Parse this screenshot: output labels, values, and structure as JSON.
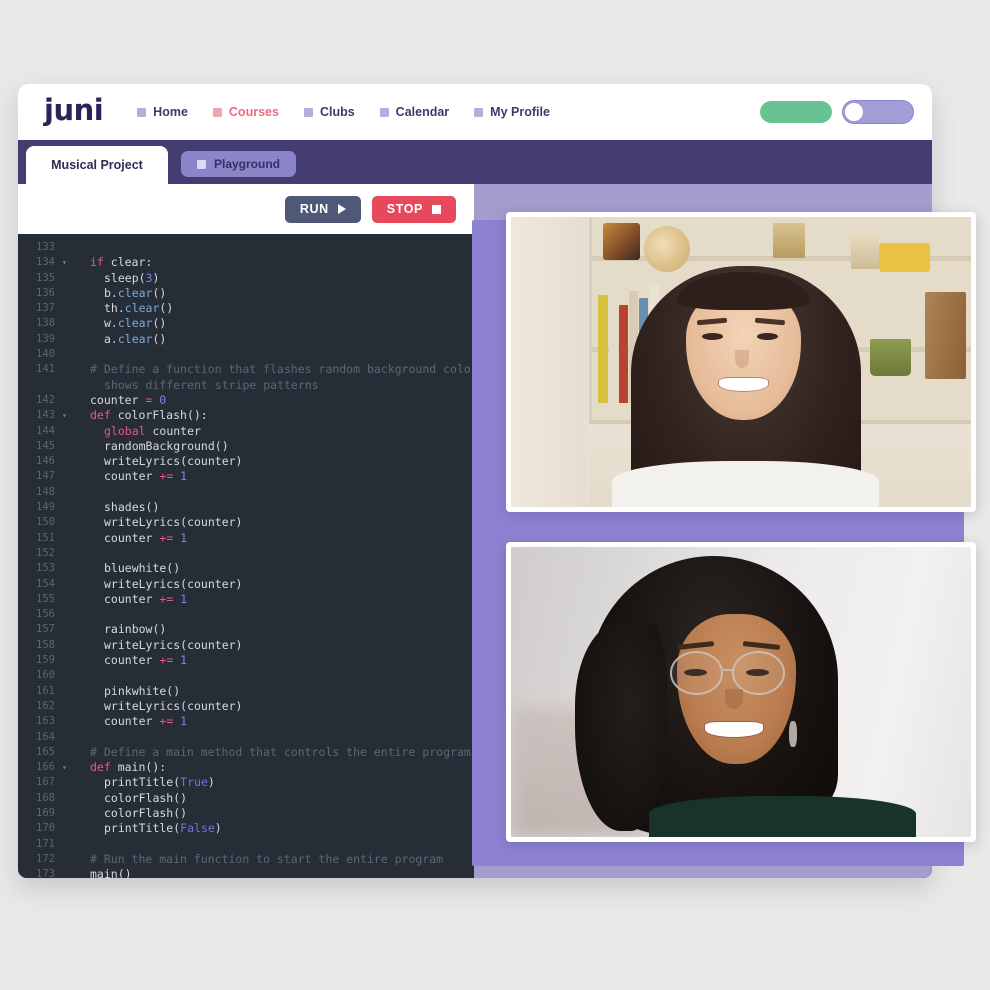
{
  "app": {
    "logo": "juni",
    "nav": [
      {
        "label": "Home",
        "icon": "square-icon",
        "active": false
      },
      {
        "label": "Courses",
        "icon": "square-icon",
        "active": true
      },
      {
        "label": "Clubs",
        "icon": "square-icon",
        "active": false
      },
      {
        "label": "Calendar",
        "icon": "square-icon",
        "active": false
      },
      {
        "label": "My Profile",
        "icon": "square-icon",
        "active": false
      }
    ],
    "controls": {
      "green_pill": "",
      "toggle": "",
      "toggle_state": "off"
    }
  },
  "tabs": {
    "active": "Musical Project",
    "playground": "Playground",
    "playground_icon": "square-icon"
  },
  "toolbar": {
    "run_label": "RUN",
    "run_icon": "play-triangle-icon",
    "stop_label": "STOP",
    "stop_icon": "stop-square-icon"
  },
  "editor": {
    "language": "python",
    "first_line": 133,
    "last_line": 173,
    "lines": [
      {
        "n": 133,
        "fold": "",
        "indent": 0,
        "tokens": []
      },
      {
        "n": 134,
        "fold": "v",
        "indent": 1,
        "tokens": [
          {
            "t": "if ",
            "c": "kw"
          },
          {
            "t": "clear:",
            "c": "code-txt"
          }
        ]
      },
      {
        "n": 135,
        "fold": "",
        "indent": 2,
        "tokens": [
          {
            "t": "sleep(",
            "c": "code-txt"
          },
          {
            "t": "3",
            "c": "num"
          },
          {
            "t": ")",
            "c": "code-txt"
          }
        ]
      },
      {
        "n": 136,
        "fold": "",
        "indent": 2,
        "tokens": [
          {
            "t": "b.",
            "c": "code-txt"
          },
          {
            "t": "clear",
            "c": "method"
          },
          {
            "t": "()",
            "c": "code-txt"
          }
        ]
      },
      {
        "n": 137,
        "fold": "",
        "indent": 2,
        "tokens": [
          {
            "t": "th.",
            "c": "code-txt"
          },
          {
            "t": "clear",
            "c": "method"
          },
          {
            "t": "()",
            "c": "code-txt"
          }
        ]
      },
      {
        "n": 138,
        "fold": "",
        "indent": 2,
        "tokens": [
          {
            "t": "w.",
            "c": "code-txt"
          },
          {
            "t": "clear",
            "c": "method"
          },
          {
            "t": "()",
            "c": "code-txt"
          }
        ]
      },
      {
        "n": 139,
        "fold": "",
        "indent": 2,
        "tokens": [
          {
            "t": "a.",
            "c": "code-txt"
          },
          {
            "t": "clear",
            "c": "method"
          },
          {
            "t": "()",
            "c": "code-txt"
          }
        ]
      },
      {
        "n": 140,
        "fold": "",
        "indent": 0,
        "tokens": []
      },
      {
        "n": 141,
        "fold": "",
        "indent": 1,
        "tokens": [
          {
            "t": "# Define a function that flashes random background colors, ma",
            "c": "comment"
          }
        ]
      },
      {
        "n": "",
        "fold": "",
        "indent": 2,
        "tokens": [
          {
            "t": "shows different stripe patterns",
            "c": "comment"
          }
        ]
      },
      {
        "n": 142,
        "fold": "",
        "indent": 1,
        "tokens": [
          {
            "t": "counter ",
            "c": "code-txt"
          },
          {
            "t": "= ",
            "c": "op"
          },
          {
            "t": "0",
            "c": "num"
          }
        ]
      },
      {
        "n": 143,
        "fold": "v",
        "indent": 1,
        "tokens": [
          {
            "t": "def ",
            "c": "kw"
          },
          {
            "t": "colorFlash():",
            "c": "code-txt"
          }
        ]
      },
      {
        "n": 144,
        "fold": "",
        "indent": 2,
        "tokens": [
          {
            "t": "global ",
            "c": "kw"
          },
          {
            "t": "counter",
            "c": "code-txt"
          }
        ]
      },
      {
        "n": 145,
        "fold": "",
        "indent": 2,
        "tokens": [
          {
            "t": "randomBackground()",
            "c": "code-txt"
          }
        ]
      },
      {
        "n": 146,
        "fold": "",
        "indent": 2,
        "tokens": [
          {
            "t": "writeLyrics(counter)",
            "c": "code-txt"
          }
        ]
      },
      {
        "n": 147,
        "fold": "",
        "indent": 2,
        "tokens": [
          {
            "t": "counter ",
            "c": "code-txt"
          },
          {
            "t": "+= ",
            "c": "op"
          },
          {
            "t": "1",
            "c": "num"
          }
        ]
      },
      {
        "n": 148,
        "fold": "",
        "indent": 0,
        "tokens": []
      },
      {
        "n": 149,
        "fold": "",
        "indent": 2,
        "tokens": [
          {
            "t": "shades()",
            "c": "code-txt"
          }
        ]
      },
      {
        "n": 150,
        "fold": "",
        "indent": 2,
        "tokens": [
          {
            "t": "writeLyrics(counter)",
            "c": "code-txt"
          }
        ]
      },
      {
        "n": 151,
        "fold": "",
        "indent": 2,
        "tokens": [
          {
            "t": "counter ",
            "c": "code-txt"
          },
          {
            "t": "+= ",
            "c": "op"
          },
          {
            "t": "1",
            "c": "num"
          }
        ]
      },
      {
        "n": 152,
        "fold": "",
        "indent": 0,
        "tokens": []
      },
      {
        "n": 153,
        "fold": "",
        "indent": 2,
        "tokens": [
          {
            "t": "bluewhite()",
            "c": "code-txt"
          }
        ]
      },
      {
        "n": 154,
        "fold": "",
        "indent": 2,
        "tokens": [
          {
            "t": "writeLyrics(counter)",
            "c": "code-txt"
          }
        ]
      },
      {
        "n": 155,
        "fold": "",
        "indent": 2,
        "tokens": [
          {
            "t": "counter ",
            "c": "code-txt"
          },
          {
            "t": "+= ",
            "c": "op"
          },
          {
            "t": "1",
            "c": "num"
          }
        ]
      },
      {
        "n": 156,
        "fold": "",
        "indent": 0,
        "tokens": []
      },
      {
        "n": 157,
        "fold": "",
        "indent": 2,
        "tokens": [
          {
            "t": "rainbow()",
            "c": "code-txt"
          }
        ]
      },
      {
        "n": 158,
        "fold": "",
        "indent": 2,
        "tokens": [
          {
            "t": "writeLyrics(counter)",
            "c": "code-txt"
          }
        ]
      },
      {
        "n": 159,
        "fold": "",
        "indent": 2,
        "tokens": [
          {
            "t": "counter ",
            "c": "code-txt"
          },
          {
            "t": "+= ",
            "c": "op"
          },
          {
            "t": "1",
            "c": "num"
          }
        ]
      },
      {
        "n": 160,
        "fold": "",
        "indent": 0,
        "tokens": []
      },
      {
        "n": 161,
        "fold": "",
        "indent": 2,
        "tokens": [
          {
            "t": "pinkwhite()",
            "c": "code-txt"
          }
        ]
      },
      {
        "n": 162,
        "fold": "",
        "indent": 2,
        "tokens": [
          {
            "t": "writeLyrics(counter)",
            "c": "code-txt"
          }
        ]
      },
      {
        "n": 163,
        "fold": "",
        "indent": 2,
        "tokens": [
          {
            "t": "counter ",
            "c": "code-txt"
          },
          {
            "t": "+= ",
            "c": "op"
          },
          {
            "t": "1",
            "c": "num"
          }
        ]
      },
      {
        "n": 164,
        "fold": "",
        "indent": 0,
        "tokens": []
      },
      {
        "n": 165,
        "fold": "",
        "indent": 1,
        "tokens": [
          {
            "t": "# Define a main method that controls the entire program",
            "c": "comment"
          }
        ]
      },
      {
        "n": 166,
        "fold": "v",
        "indent": 1,
        "tokens": [
          {
            "t": "def ",
            "c": "kw"
          },
          {
            "t": "main():",
            "c": "code-txt"
          }
        ]
      },
      {
        "n": 167,
        "fold": "",
        "indent": 2,
        "tokens": [
          {
            "t": "printTitle(",
            "c": "code-txt"
          },
          {
            "t": "True",
            "c": "bool"
          },
          {
            "t": ")",
            "c": "code-txt"
          }
        ]
      },
      {
        "n": 168,
        "fold": "",
        "indent": 2,
        "tokens": [
          {
            "t": "colorFlash()",
            "c": "code-txt"
          }
        ]
      },
      {
        "n": 169,
        "fold": "",
        "indent": 2,
        "tokens": [
          {
            "t": "colorFlash()",
            "c": "code-txt"
          }
        ]
      },
      {
        "n": 170,
        "fold": "",
        "indent": 2,
        "tokens": [
          {
            "t": "printTitle(",
            "c": "code-txt"
          },
          {
            "t": "False",
            "c": "bool"
          },
          {
            "t": ")",
            "c": "code-txt"
          }
        ]
      },
      {
        "n": 171,
        "fold": "",
        "indent": 0,
        "tokens": []
      },
      {
        "n": 172,
        "fold": "",
        "indent": 1,
        "tokens": [
          {
            "t": "# Run the main function to start the entire program",
            "c": "comment"
          }
        ]
      },
      {
        "n": 173,
        "fold": "",
        "indent": 1,
        "tokens": [
          {
            "t": "main()",
            "c": "code-txt"
          }
        ]
      }
    ]
  },
  "video_panel": {
    "participants": [
      {
        "name": "participant-1",
        "description": "Smiling young woman with long dark hair wearing a white top, seated in front of a cream bookshelf with books, a shell, a green cup and yellow objects"
      },
      {
        "name": "participant-2",
        "description": "Smiling woman with curly dark hair and round glasses wearing a dark green top against a light grey wall"
      }
    ]
  },
  "colors": {
    "page_background": "#e9e9e9",
    "nav_background": "#ffffff",
    "header_purple": "#443d72",
    "band_purple": "#a39dcd",
    "backing_purple": "#8d82d2",
    "logo_navy": "#2a2359",
    "accent_pink": "#ef6b7d",
    "green_pill": "#68c291",
    "toggle_purple": "#a39dd7",
    "run_slate": "#4f5876",
    "stop_red": "#e8485c",
    "editor_background": "#272d36",
    "code_text": "#d5dae2",
    "code_keyword": "#e8568a",
    "code_number": "#8a7ee8",
    "code_method": "#7fa8d8",
    "code_comment": "#5d6673",
    "gutter_text": "#5b6470"
  }
}
